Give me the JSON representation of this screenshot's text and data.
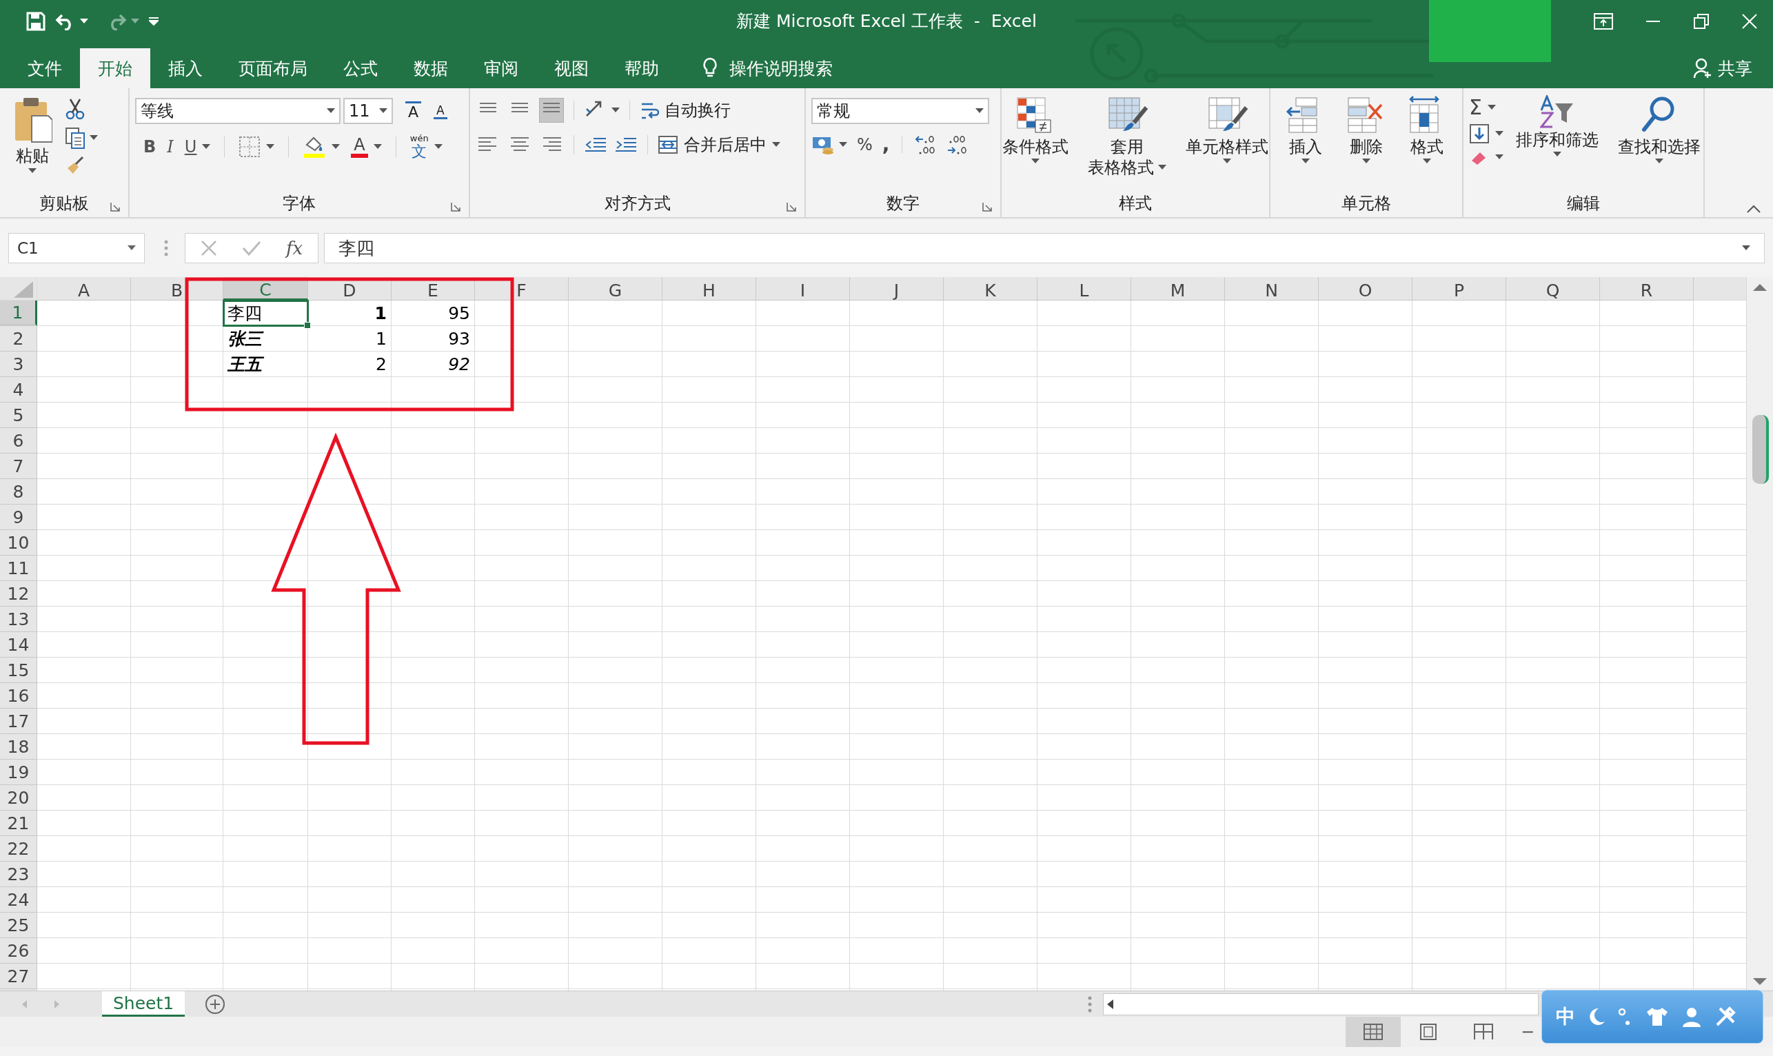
{
  "window": {
    "title": "新建 Microsoft Excel 工作表  -  Excel",
    "share": "共享"
  },
  "menu_tabs": [
    {
      "label": "文件",
      "selected": false
    },
    {
      "label": "开始",
      "selected": true
    },
    {
      "label": "插入",
      "selected": false
    },
    {
      "label": "页面布局",
      "selected": false
    },
    {
      "label": "公式",
      "selected": false
    },
    {
      "label": "数据",
      "selected": false
    },
    {
      "label": "审阅",
      "selected": false
    },
    {
      "label": "视图",
      "selected": false
    },
    {
      "label": "帮助",
      "selected": false
    }
  ],
  "tell_me": "操作说明搜索",
  "ribbon": {
    "groups": [
      {
        "kind": "clipboard",
        "label": "剪贴板",
        "launcher": true,
        "paste": "粘贴"
      },
      {
        "kind": "font",
        "label": "字体",
        "launcher": true,
        "font_name": "等线",
        "font_size": "11",
        "grow": "A",
        "shrink": "A",
        "bold": "B",
        "italic": "I",
        "underline": "U",
        "font_color": "A",
        "phonetic_top": "wén",
        "phonetic": "文"
      },
      {
        "kind": "alignment",
        "label": "对齐方式",
        "launcher": true,
        "wrap": "自动换行",
        "merge": "合并后居中"
      },
      {
        "kind": "number",
        "label": "数字",
        "launcher": true,
        "format": "常规",
        "percent": "%",
        "comma": ","
      },
      {
        "kind": "big",
        "label": "样式",
        "launcher": false,
        "buttons": [
          {
            "kind": "conditional",
            "lines": [
              "条件格式"
            ]
          },
          {
            "kind": "table",
            "lines": [
              "套用",
              "表格格式"
            ]
          },
          {
            "kind": "cellstyle",
            "lines": [
              "单元格样式"
            ]
          }
        ]
      },
      {
        "kind": "big",
        "label": "单元格",
        "launcher": false,
        "buttons": [
          {
            "kind": "insert",
            "lines": [
              "插入"
            ]
          },
          {
            "kind": "delete",
            "lines": [
              "删除"
            ]
          },
          {
            "kind": "format",
            "lines": [
              "格式"
            ]
          }
        ]
      },
      {
        "kind": "editing",
        "label": "编辑",
        "launcher": false,
        "sum": "Σ",
        "buttons": [
          {
            "kind": "sort",
            "lines": [
              "排序和筛选"
            ]
          },
          {
            "kind": "find",
            "lines": [
              "查找和选择"
            ]
          }
        ]
      }
    ]
  },
  "formula_bar": {
    "name_box": "C1",
    "fx": "fx",
    "formula": "李四"
  },
  "sheet": {
    "columns": [
      {
        "label": "A",
        "selected": false
      },
      {
        "label": "B",
        "selected": false
      },
      {
        "label": "C",
        "selected": true,
        "cells": [
          {
            "text": "李四",
            "kind": "text",
            "bold": false,
            "italic": false,
            "selected": true
          },
          {
            "text": "张三",
            "kind": "text",
            "bold": true,
            "italic": true,
            "selected": false
          },
          {
            "text": "王五",
            "kind": "text",
            "bold": true,
            "italic": true,
            "selected": false
          }
        ]
      },
      {
        "label": "D",
        "selected": false,
        "cells": [
          {
            "text": "1",
            "kind": "number",
            "bold": true,
            "italic": false,
            "selected": false
          },
          {
            "text": "1",
            "kind": "number",
            "bold": false,
            "italic": false,
            "selected": false
          },
          {
            "text": "2",
            "kind": "number",
            "bold": false,
            "italic": false,
            "selected": false
          }
        ]
      },
      {
        "label": "E",
        "selected": false,
        "cells": [
          {
            "text": "95",
            "kind": "number",
            "bold": false,
            "italic": false,
            "selected": false
          },
          {
            "text": "93",
            "kind": "number",
            "bold": false,
            "italic": false,
            "selected": false
          },
          {
            "text": "92",
            "kind": "number",
            "bold": false,
            "italic": true,
            "selected": false
          }
        ]
      },
      {
        "label": "F",
        "selected": false
      },
      {
        "label": "G",
        "selected": false
      },
      {
        "label": "H",
        "selected": false
      },
      {
        "label": "I",
        "selected": false
      },
      {
        "label": "J",
        "selected": false
      },
      {
        "label": "K",
        "selected": false
      },
      {
        "label": "L",
        "selected": false
      },
      {
        "label": "M",
        "selected": false
      },
      {
        "label": "N",
        "selected": false
      },
      {
        "label": "O",
        "selected": false
      },
      {
        "label": "P",
        "selected": false
      },
      {
        "label": "Q",
        "selected": false
      },
      {
        "label": "R",
        "selected": false
      }
    ],
    "rows": [
      {
        "label": "1",
        "selected": true
      },
      {
        "label": "2",
        "selected": false
      },
      {
        "label": "3",
        "selected": false
      },
      {
        "label": "4",
        "selected": false
      },
      {
        "label": "5",
        "selected": false
      },
      {
        "label": "6",
        "selected": false
      },
      {
        "label": "7",
        "selected": false
      },
      {
        "label": "8",
        "selected": false
      },
      {
        "label": "9",
        "selected": false
      },
      {
        "label": "10",
        "selected": false
      },
      {
        "label": "11",
        "selected": false
      },
      {
        "label": "12",
        "selected": false
      },
      {
        "label": "13",
        "selected": false
      },
      {
        "label": "14",
        "selected": false
      },
      {
        "label": "15",
        "selected": false
      },
      {
        "label": "16",
        "selected": false
      },
      {
        "label": "17",
        "selected": false
      },
      {
        "label": "18",
        "selected": false
      },
      {
        "label": "19",
        "selected": false
      },
      {
        "label": "20",
        "selected": false
      },
      {
        "label": "21",
        "selected": false
      },
      {
        "label": "22",
        "selected": false
      },
      {
        "label": "23",
        "selected": false
      },
      {
        "label": "24",
        "selected": false
      },
      {
        "label": "25",
        "selected": false
      },
      {
        "label": "26",
        "selected": false
      },
      {
        "label": "27",
        "selected": false
      }
    ]
  },
  "sheet_tabs": [
    {
      "label": "Sheet1",
      "selected": true
    }
  ],
  "status_bar": {
    "views": [
      {
        "kind": "normal",
        "selected": true
      },
      {
        "kind": "layout",
        "selected": false
      },
      {
        "kind": "pagebreak",
        "selected": false
      }
    ],
    "zoom_out": "−"
  },
  "ime_bar": {
    "mode": "中"
  }
}
